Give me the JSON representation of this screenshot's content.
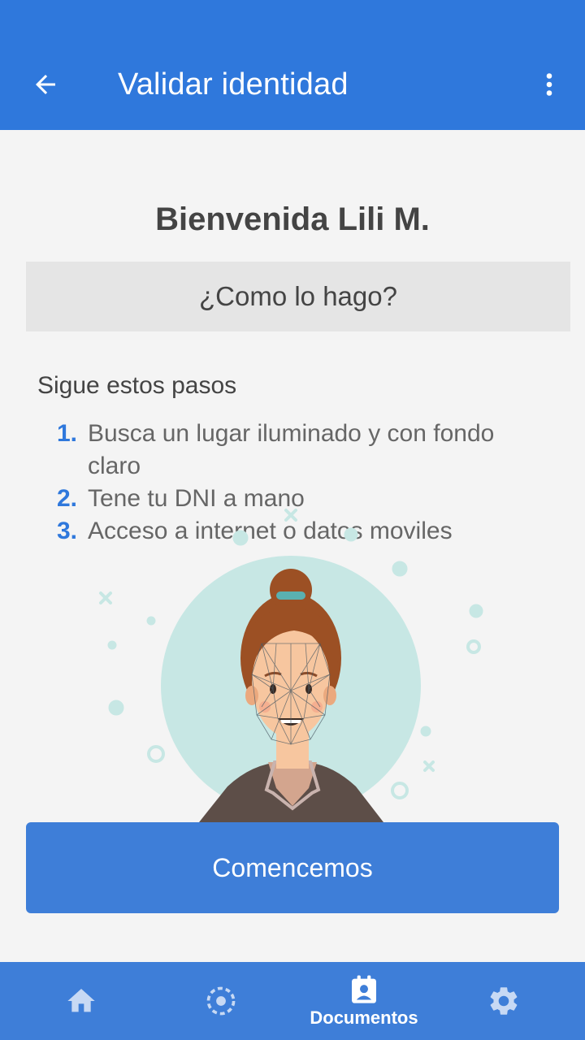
{
  "appbar": {
    "title": "Validar identidad",
    "back_icon": "arrow-back-icon",
    "menu_icon": "more-vert-icon"
  },
  "welcome": "Bienvenida Lili M.",
  "how_label": "¿Como lo hago?",
  "steps_title": "Sigue estos pasos",
  "steps": [
    {
      "num": "1.",
      "text": "Busca un lugar iluminado y con fondo claro"
    },
    {
      "num": "2.",
      "text": "Tene tu DNI a mano"
    },
    {
      "num": "3.",
      "text": "Acceso a internet o datos moviles"
    }
  ],
  "cta_label": "Comencemos",
  "bottom_nav": {
    "items": [
      {
        "icon": "home-icon",
        "label": ""
      },
      {
        "icon": "face-scan-icon",
        "label": ""
      },
      {
        "icon": "badge-icon",
        "label": "Documentos",
        "active": true
      },
      {
        "icon": "settings-icon",
        "label": ""
      }
    ]
  },
  "colors": {
    "primary": "#2f78dc",
    "button": "#3e7ed8",
    "background": "#f4f4f4",
    "howbar": "#e5e5e5"
  }
}
